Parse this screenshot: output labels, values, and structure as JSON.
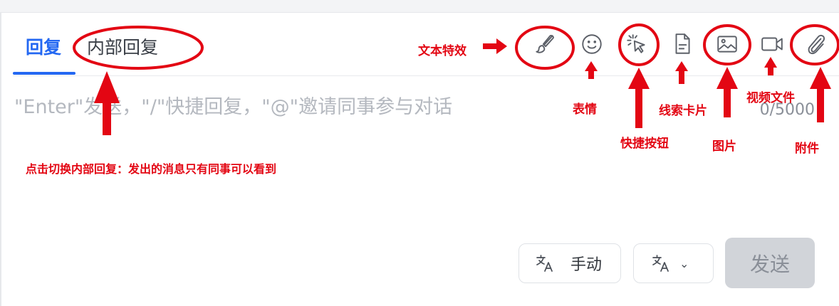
{
  "tabs": [
    {
      "label": "回复",
      "active": true
    },
    {
      "label": "内部回复",
      "active": false
    }
  ],
  "composer": {
    "placeholder": "\"Enter\"发送，\"/\"快捷回复，\"@\"邀请同事参与对话",
    "counter": "0/5000"
  },
  "toolbar": {
    "icons": [
      "brush-icon",
      "smile-icon",
      "cursor-click-icon",
      "document-icon",
      "image-icon",
      "video-icon",
      "paperclip-icon"
    ]
  },
  "footer": {
    "translate_manual_label": "手动",
    "send_label": "发送"
  },
  "annotations": {
    "text_effects": "文本特效",
    "emoji": "表情",
    "quick_button": "快捷按钮",
    "lead_card": "线索卡片",
    "image": "图片",
    "video_file": "视频文件",
    "attachment": "附件",
    "internal_note": "点击切换内部回复：发出的消息只有同事可以看到"
  },
  "colors": {
    "accent": "#2468f2",
    "annotation": "#e30613",
    "send_disabled": "#d1d4d9"
  }
}
